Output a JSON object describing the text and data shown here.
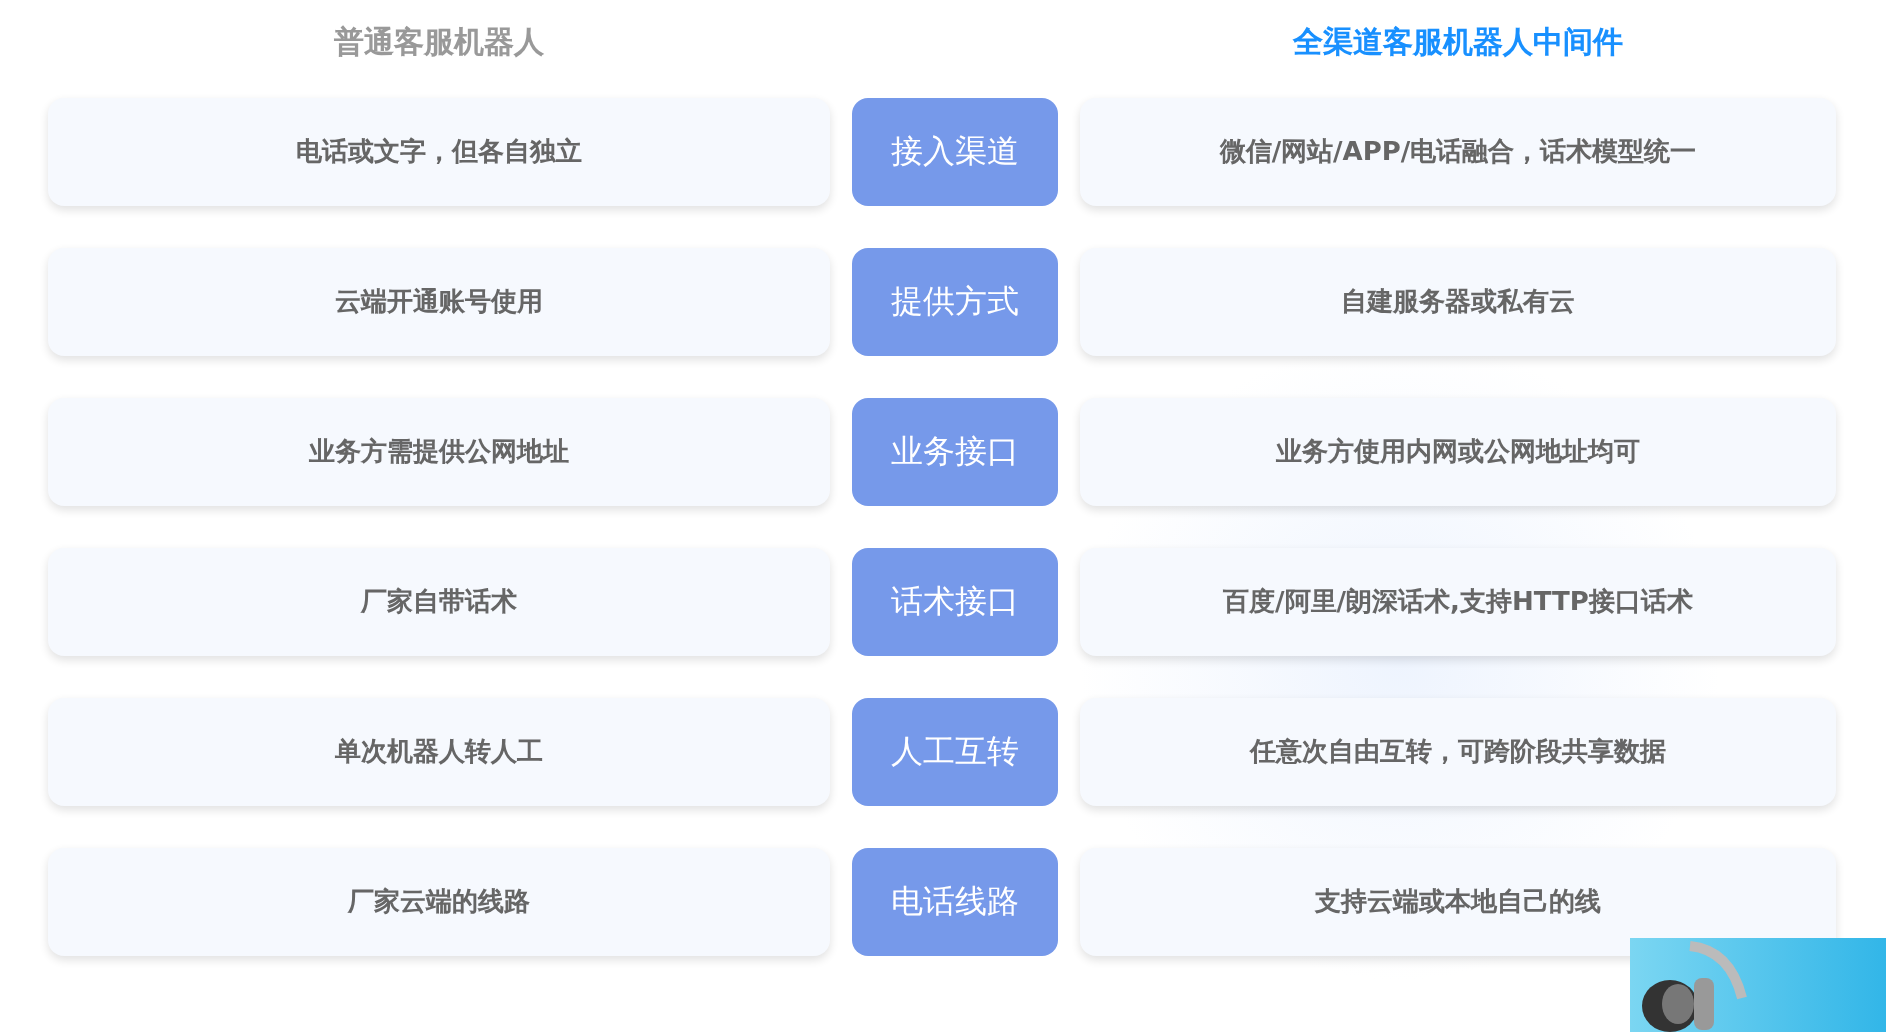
{
  "headers": {
    "left": "普通客服机器人",
    "right": "全渠道客服机器人中间件"
  },
  "rows": [
    {
      "left": "电话或文字，但各自独立",
      "label": "接入渠道",
      "right": "微信/网站/APP/电话融合，话术模型统一"
    },
    {
      "left": "云端开通账号使用",
      "label": "提供方式",
      "right": "自建服务器或私有云"
    },
    {
      "left": "业务方需提供公网地址",
      "label": "业务接口",
      "right": "业务方使用内网或公网地址均可"
    },
    {
      "left": "厂家自带话术",
      "label": "话术接口",
      "right": "百度/阿里/朗深话术,支持HTTP接口话术"
    },
    {
      "left": "单次机器人转人工",
      "label": "人工互转",
      "right": "任意次自由互转，可跨阶段共享数据"
    },
    {
      "left": "厂家云端的线路",
      "label": "电话线路",
      "right": "支持云端或本地自己的线"
    }
  ]
}
